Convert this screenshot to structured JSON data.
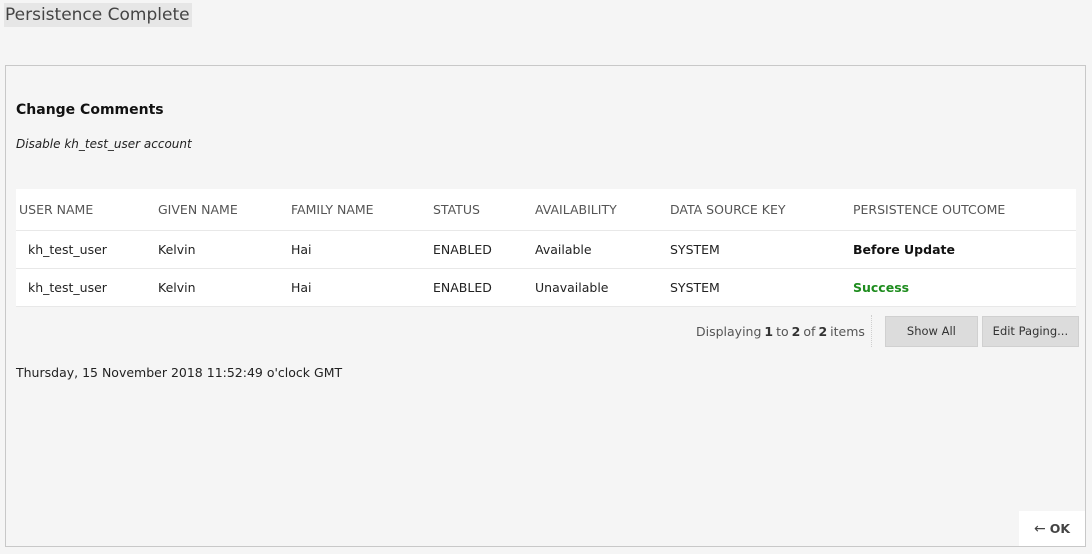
{
  "page": {
    "title": "Persistence Complete"
  },
  "comments": {
    "heading": "Change Comments",
    "text": "Disable kh_test_user account"
  },
  "table": {
    "columns": {
      "user_name": "USER NAME",
      "given_name": "GIVEN NAME",
      "family_name": "FAMILY NAME",
      "status": "STATUS",
      "availability": "AVAILABILITY",
      "data_source_key": "DATA SOURCE KEY",
      "persistence_outcome": "PERSISTENCE OUTCOME"
    },
    "rows": [
      {
        "user_name": "kh_test_user",
        "given_name": "Kelvin",
        "family_name": "Hai",
        "status": "ENABLED",
        "availability": "Available",
        "data_source_key": "SYSTEM",
        "persistence_outcome": "Before Update"
      },
      {
        "user_name": "kh_test_user",
        "given_name": "Kelvin",
        "family_name": "Hai",
        "status": "ENABLED",
        "availability": "Unavailable",
        "data_source_key": "SYSTEM",
        "persistence_outcome": "Success"
      }
    ]
  },
  "pager": {
    "prefix": "Displaying",
    "from": "1",
    "to_word": "to",
    "to": "2",
    "of_word": "of",
    "total": "2",
    "suffix": "items",
    "show_all_label": "Show All",
    "edit_paging_label": "Edit Paging..."
  },
  "timestamp": "Thursday, 15 November 2018 11:52:49 o'clock GMT",
  "actions": {
    "ok_arrow": "←",
    "ok_label": "OK"
  },
  "colors": {
    "success": "#1e8c1e",
    "button_bg": "#dcdcdc",
    "panel_border": "#c8c8c8"
  }
}
